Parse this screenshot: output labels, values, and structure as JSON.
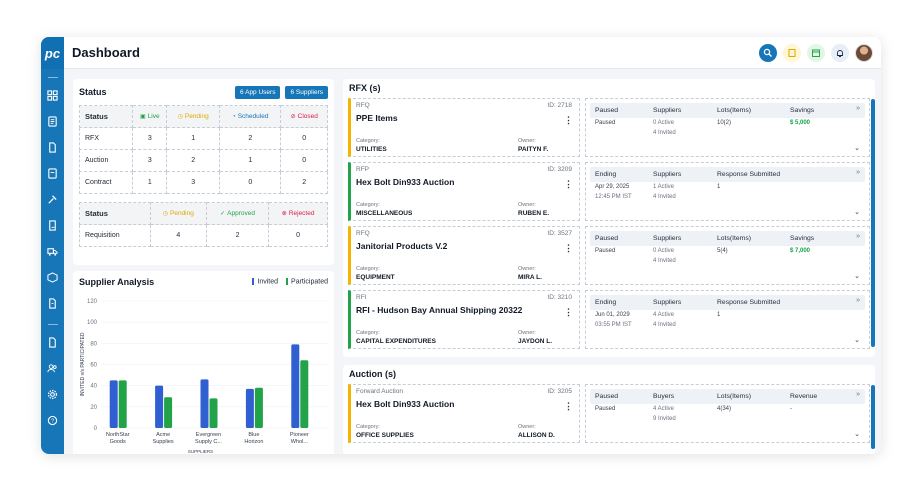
{
  "header": {
    "logo": "pc",
    "title": "Dashboard"
  },
  "status": {
    "title": "Status",
    "app_users_button": "6  App Users",
    "suppliers_button": "6  Suppliers",
    "table1": {
      "headers": [
        "Status",
        "Live",
        "Pending",
        "Scheduled",
        "Closed"
      ],
      "rows": [
        [
          "RFX",
          "3",
          "1",
          "2",
          "0"
        ],
        [
          "Auction",
          "3",
          "2",
          "1",
          "0"
        ],
        [
          "Contract",
          "1",
          "3",
          "0",
          "2"
        ]
      ]
    },
    "table2": {
      "headers": [
        "Status",
        "Pending",
        "Approved",
        "Rejected"
      ],
      "rows": [
        [
          "Requisition",
          "4",
          "2",
          "0"
        ]
      ]
    }
  },
  "supplier_analysis": {
    "title": "Supplier Analysis",
    "legend_invited": "Invited",
    "legend_participated": "Participated"
  },
  "chart_data": {
    "type": "bar",
    "categories": [
      "NorthStar Goods",
      "Acme Supplies",
      "Evergreen Supply C...",
      "Blue Horizon",
      "Pioneer Whol..."
    ],
    "series": [
      {
        "name": "Invited",
        "values": [
          45,
          40,
          46,
          37,
          79
        ]
      },
      {
        "name": "Participated",
        "values": [
          45,
          29,
          28,
          38,
          64
        ]
      }
    ],
    "ylabel": "INVITED v/s PARTICIPATED",
    "xlabel": "SUPPLIERS",
    "ylim": [
      0,
      120
    ],
    "yticks": [
      "120",
      "100",
      "80",
      "60",
      "40",
      "20",
      "0"
    ],
    "colors": {
      "Invited": "#2f5fd0",
      "Participated": "#22a34a"
    }
  },
  "rfx": {
    "title": "RFX (s)",
    "items": [
      {
        "type": "RFQ",
        "id": "ID: 2718",
        "name": "PPE Items",
        "category_label": "Category:",
        "category": "UTILITIES",
        "owner_label": "Owner:",
        "owner": "PAITYN F.",
        "headers": [
          "Paused",
          "Suppliers",
          "Lots(Items)",
          "Savings"
        ],
        "status": "Paused",
        "suppliers_active": "0 Active",
        "suppliers_invited": "4 Invited",
        "lots": "10(2)",
        "savings": "$ 5,000"
      },
      {
        "type": "RFP",
        "id": "ID: 3209",
        "name": "Hex Bolt Din933 Auction",
        "category_label": "Category:",
        "category": "MISCELLANEOUS",
        "owner_label": "Owner:",
        "owner": "RUBEN E.",
        "headers": [
          "Ending",
          "Suppliers",
          "Response Submitted"
        ],
        "date": "Apr 29, 2025",
        "time": "12:45 PM IST",
        "suppliers_active": "1 Active",
        "suppliers_invited": "4 Invited",
        "response": "1"
      },
      {
        "type": "RFQ",
        "id": "ID: 3527",
        "name": "Janitorial Products V.2",
        "category_label": "Category:",
        "category": "EQUIPMENT",
        "owner_label": "Owner:",
        "owner": "MIRA L.",
        "headers": [
          "Paused",
          "Suppliers",
          "Lots(Items)",
          "Savings"
        ],
        "status": "Paused",
        "suppliers_active": "0 Active",
        "suppliers_invited": "4 Invited",
        "lots": "5(4)",
        "savings": "$ 7,000"
      },
      {
        "type": "RFI",
        "id": "ID: 3210",
        "name": "RFI - Hudson Bay Annual Shipping 20322",
        "category_label": "Category:",
        "category": "CAPITAL EXPENDITURES",
        "owner_label": "Owner:",
        "owner": "JAYDON L.",
        "headers": [
          "Ending",
          "Suppliers",
          "Response Submitted"
        ],
        "date": "Jun 01, 2029",
        "time": "03:55 PM IST",
        "suppliers_active": "4 Active",
        "suppliers_invited": "4 Invited",
        "response": "1"
      }
    ]
  },
  "auction": {
    "title": "Auction (s)",
    "items": [
      {
        "type": "Forward Auction",
        "id": "ID: 3205",
        "name": "Hex Bolt Din933 Auction",
        "category_label": "Category:",
        "category": "OFFICE SUPPLIES",
        "owner_label": "Owner:",
        "owner": "ALLISON D.",
        "headers": [
          "Paused",
          "Buyers",
          "Lots(Items)",
          "Revenue"
        ],
        "status": "Paused",
        "buyers_active": "4 Active",
        "buyers_invited": "9 Invited",
        "lots": "4(34)",
        "revenue": "-"
      }
    ]
  },
  "colors": {
    "brand": "#1676b8",
    "yellow": "#f5b400",
    "green": "#22a34a",
    "red": "#e11d48"
  }
}
